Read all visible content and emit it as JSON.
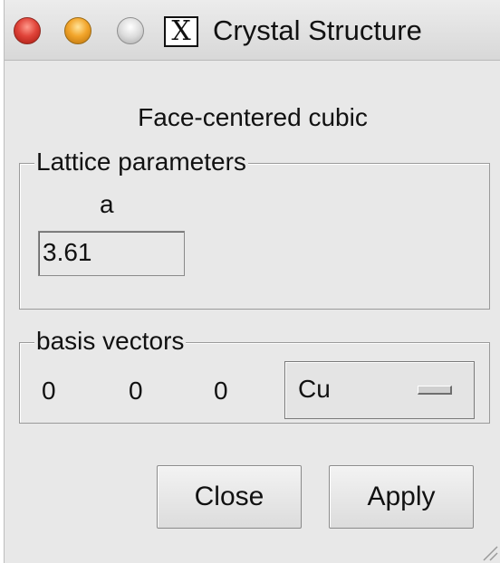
{
  "window": {
    "title": "Crystal Structure",
    "x11_glyph": "X",
    "traffic_lights": [
      "close-icon",
      "minimize-icon",
      "zoom-icon"
    ]
  },
  "heading": "Face-centered cubic",
  "lattice": {
    "label": "Lattice parameters",
    "param_name": "a",
    "param_value": "3.61"
  },
  "basis": {
    "label": "basis vectors",
    "vector": [
      "0",
      "0",
      "0"
    ],
    "element": "Cu"
  },
  "buttons": {
    "close": "Close",
    "apply": "Apply"
  }
}
